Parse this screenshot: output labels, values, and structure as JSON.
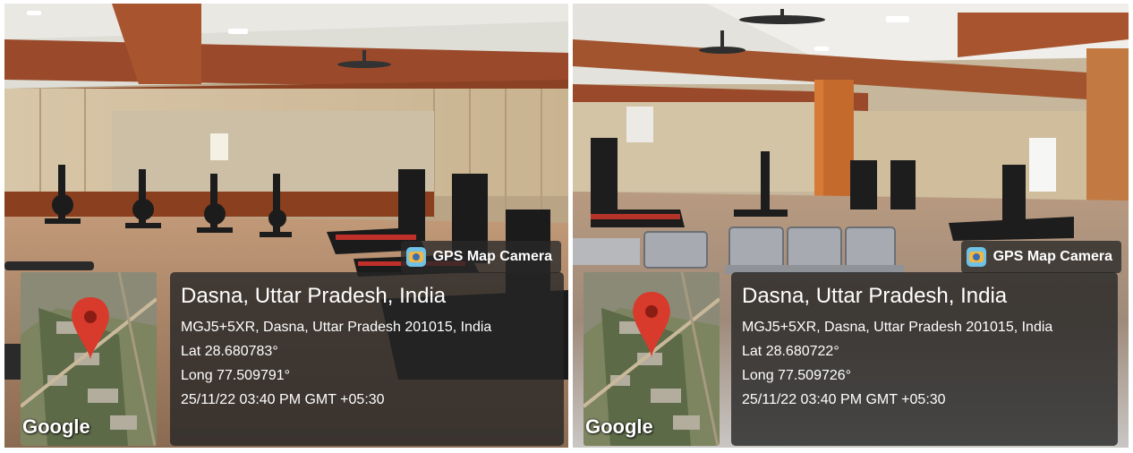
{
  "photos": [
    {
      "badge": "GPS Map Camera",
      "location_title": "Dasna, Uttar Pradesh, India",
      "address": "MGJ5+5XR, Dasna, Uttar Pradesh 201015, India",
      "latitude": "Lat 28.680783°",
      "longitude": "Long 77.509791°",
      "datetime": "25/11/22 03:40 PM GMT +05:30",
      "map_brand": "Google"
    },
    {
      "badge": "GPS Map Camera",
      "location_title": "Dasna, Uttar Pradesh, India",
      "address": "MGJ5+5XR, Dasna, Uttar Pradesh 201015, India",
      "latitude": "Lat 28.680722°",
      "longitude": "Long 77.509726°",
      "datetime": "25/11/22 03:40 PM GMT +05:30",
      "map_brand": "Google"
    }
  ],
  "icons": {
    "camera_app": "gps-map-camera-icon",
    "map_pin": "map-pin-icon"
  },
  "colors": {
    "pin": "#d83a2c",
    "overlay": "#262626"
  }
}
